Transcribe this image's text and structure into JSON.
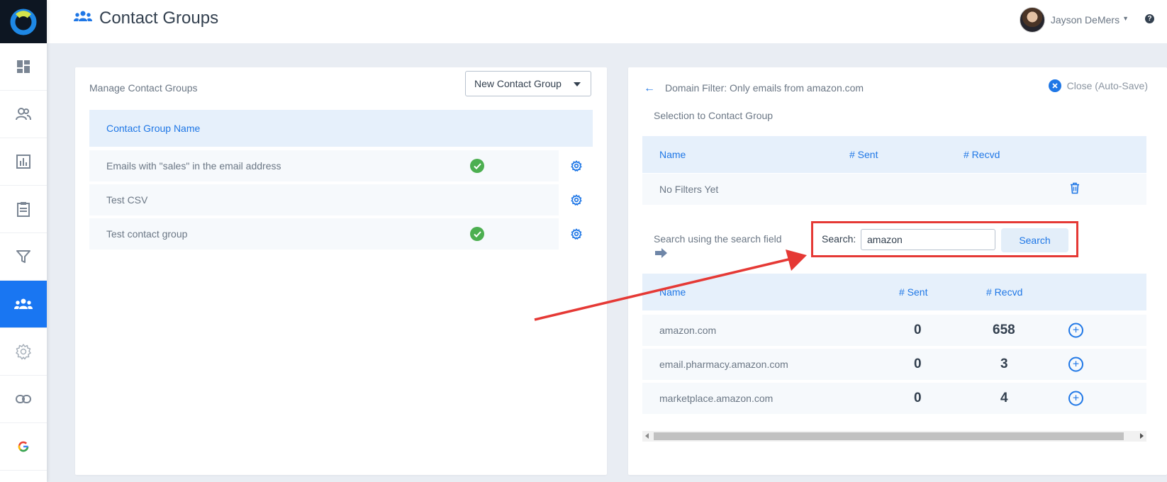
{
  "app": {
    "title": "Contact Groups",
    "user_name": "Jayson DeMers",
    "help_glyph": "?"
  },
  "sidebar": {
    "active_color": "#1976f2",
    "items": [
      {
        "icon": "dashboard-icon"
      },
      {
        "icon": "users-icon"
      },
      {
        "icon": "bar-chart-icon"
      },
      {
        "icon": "clipboard-icon"
      },
      {
        "icon": "filter-icon"
      },
      {
        "icon": "contact-groups-icon",
        "active": true
      },
      {
        "icon": "gear-icon"
      },
      {
        "icon": "link-icon"
      },
      {
        "icon": "google-icon"
      }
    ]
  },
  "left_panel": {
    "title": "Manage Contact Groups",
    "new_group_label": "New Contact Group",
    "column_header": "Contact Group Name",
    "rows": [
      {
        "name": "Emails with \"sales\" in the email address",
        "checked": true
      },
      {
        "name": "Test CSV",
        "checked": false
      },
      {
        "name": "Test contact group",
        "checked": true
      }
    ]
  },
  "right_panel": {
    "back_arrow": "←",
    "title": "Domain Filter: Only emails from amazon.com",
    "subtitle": "Selection to Contact Group",
    "close_label": "Close (Auto-Save)",
    "filters_table": {
      "headers": {
        "name": "Name",
        "sent": "# Sent",
        "recvd": "# Recvd"
      },
      "empty_text": "No Filters Yet"
    },
    "search_hint": "Search using the search field",
    "search": {
      "label": "Search:",
      "value": "amazon",
      "button_label": "Search"
    },
    "results_table": {
      "headers": {
        "name": "Name",
        "sent": "# Sent",
        "recvd": "# Recvd"
      },
      "rows": [
        {
          "name": "amazon.com",
          "sent": "0",
          "recvd": "658"
        },
        {
          "name": "email.pharmacy.amazon.com",
          "sent": "0",
          "recvd": "3"
        },
        {
          "name": "marketplace.amazon.com",
          "sent": "0",
          "recvd": "4"
        }
      ]
    }
  },
  "colors": {
    "accent": "#1f77e6",
    "annotation_red": "#e53935",
    "check_green": "#4caf50"
  }
}
